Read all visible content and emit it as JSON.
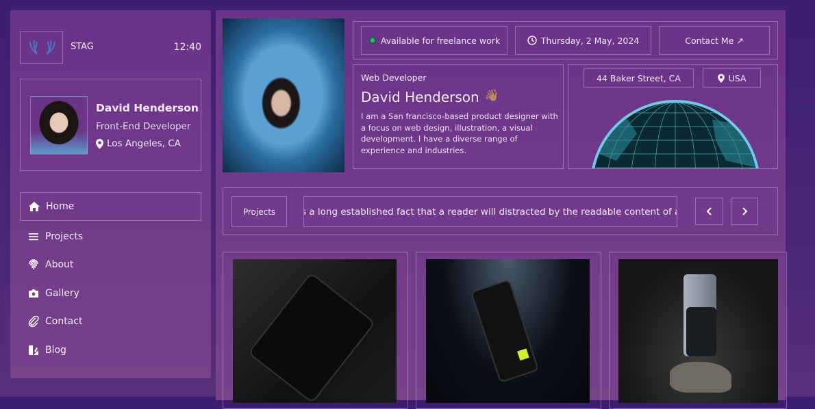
{
  "brand": {
    "name": "STAG",
    "time": "12:40",
    "logo_icon": "antlers-icon"
  },
  "profile": {
    "name": "David Henderson",
    "role": "Front-End Developer",
    "location": "Los Angeles, CA"
  },
  "nav": [
    {
      "label": "Home",
      "icon": "home-icon",
      "active": true
    },
    {
      "label": "Projects",
      "icon": "list-icon"
    },
    {
      "label": "About",
      "icon": "fingerprint-icon"
    },
    {
      "label": "Gallery",
      "icon": "camera-icon"
    },
    {
      "label": "Contact",
      "icon": "paperclip-icon"
    },
    {
      "label": "Blog",
      "icon": "blog-icon"
    }
  ],
  "topbar": {
    "status": "Available for freelance work",
    "status_color": "#22c55e",
    "date": "Thursday, 2 May, 2024",
    "contact": "Contact Me ↗"
  },
  "bio": {
    "eyebrow": "Web Developer",
    "name": "David Henderson",
    "emoji": "👋🏽",
    "text": "I am a San francisco-based product designer with a focus on web design, illustration, a visual development. I have a diverse range of experience and industries."
  },
  "location": {
    "address": "44 Baker Street, CA",
    "country": "USA"
  },
  "ticker": {
    "label": "Projects",
    "text": "s a long established fact that a reader will distracted by the readable content of a"
  },
  "colors": {
    "accent": "#6b3489",
    "globe": "#3fd7e8"
  }
}
